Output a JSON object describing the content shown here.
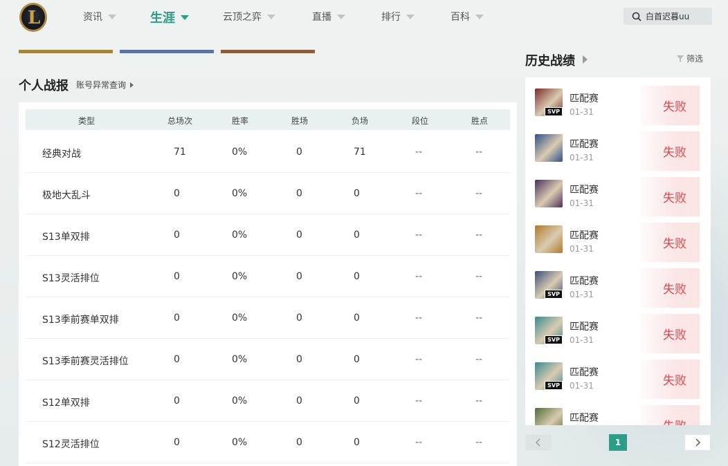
{
  "nav": {
    "items": [
      {
        "label": "资讯"
      },
      {
        "label": "生涯"
      },
      {
        "label": "云顶之弈"
      },
      {
        "label": "直播"
      },
      {
        "label": "排行"
      },
      {
        "label": "百科"
      }
    ],
    "active_index": 1
  },
  "search": {
    "value": "白首迟暮uu"
  },
  "colors": {
    "accent": "#2d9c88",
    "strip1": "#a7843e",
    "strip2": "#5a74a3",
    "strip3": "#8e5d35",
    "loss": "#e0474c"
  },
  "stats": {
    "title": "个人战报",
    "account_link": "账号异常查询",
    "headers": [
      "类型",
      "总场次",
      "胜率",
      "胜场",
      "负场",
      "段位",
      "胜点"
    ],
    "rows": [
      {
        "type": "经典对战",
        "total": "71",
        "winrate": "0%",
        "wins": "0",
        "losses": "71",
        "rank": "--",
        "lp": "--"
      },
      {
        "type": "极地大乱斗",
        "total": "0",
        "winrate": "0%",
        "wins": "0",
        "losses": "0",
        "rank": "--",
        "lp": "--"
      },
      {
        "type": "S13单双排",
        "total": "0",
        "winrate": "0%",
        "wins": "0",
        "losses": "0",
        "rank": "--",
        "lp": "--"
      },
      {
        "type": "S13灵活排位",
        "total": "0",
        "winrate": "0%",
        "wins": "0",
        "losses": "0",
        "rank": "--",
        "lp": "--"
      },
      {
        "type": "S13季前赛单双排",
        "total": "0",
        "winrate": "0%",
        "wins": "0",
        "losses": "0",
        "rank": "--",
        "lp": "--"
      },
      {
        "type": "S13季前赛灵活排位",
        "total": "0",
        "winrate": "0%",
        "wins": "0",
        "losses": "0",
        "rank": "--",
        "lp": "--"
      },
      {
        "type": "S12单双排",
        "total": "0",
        "winrate": "0%",
        "wins": "0",
        "losses": "0",
        "rank": "--",
        "lp": "--"
      },
      {
        "type": "S12灵活排位",
        "total": "0",
        "winrate": "0%",
        "wins": "0",
        "losses": "0",
        "rank": "--",
        "lp": "--"
      }
    ]
  },
  "history": {
    "title": "历史战绩",
    "filter_label": "筛选",
    "matches": [
      {
        "mode": "匹配赛",
        "date": "01-31",
        "result": "失败",
        "svp": "SVP",
        "champion_color": "#7a2a2a"
      },
      {
        "mode": "匹配赛",
        "date": "01-31",
        "result": "失败",
        "svp": "",
        "champion_color": "#2f4f8a"
      },
      {
        "mode": "匹配赛",
        "date": "01-31",
        "result": "失败",
        "svp": "",
        "champion_color": "#4a2f5e"
      },
      {
        "mode": "匹配赛",
        "date": "01-31",
        "result": "失败",
        "svp": "",
        "champion_color": "#b07a2a"
      },
      {
        "mode": "匹配赛",
        "date": "01-31",
        "result": "失败",
        "svp": "SVP",
        "champion_color": "#3a4f7a"
      },
      {
        "mode": "匹配赛",
        "date": "01-31",
        "result": "失败",
        "svp": "SVP",
        "champion_color": "#3a8a8f"
      },
      {
        "mode": "匹配赛",
        "date": "01-31",
        "result": "失败",
        "svp": "SVP",
        "champion_color": "#3a8a8f"
      },
      {
        "mode": "匹配赛",
        "date": "",
        "result": "失败",
        "svp": "",
        "champion_color": "#4f6a3a"
      }
    ],
    "page": "1"
  }
}
